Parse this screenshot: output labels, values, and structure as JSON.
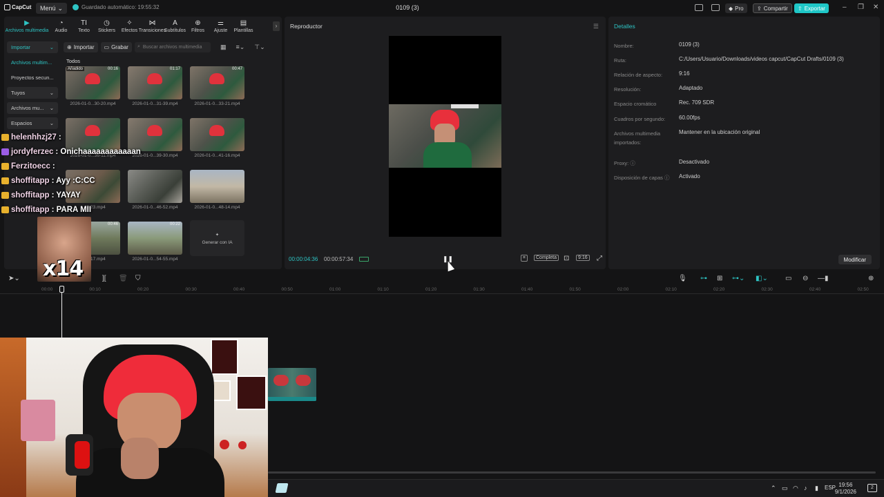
{
  "titlebar": {
    "app": "CapCut",
    "menu": "Menú",
    "autosave": "Guardado automático: 19:55:32",
    "doc_title": "0109 (3)",
    "pro": "Pro",
    "share": "Compartir",
    "export": "Exportar"
  },
  "toolbar": {
    "items": [
      {
        "label": "Archivos multimedia",
        "icon": "media-icon",
        "glyph": "▶"
      },
      {
        "label": "Audio",
        "icon": "audio-icon",
        "glyph": "◔"
      },
      {
        "label": "Texto",
        "icon": "text-icon",
        "glyph": "TI"
      },
      {
        "label": "Stickers",
        "icon": "sticker-icon",
        "glyph": "◷"
      },
      {
        "label": "Efectos",
        "icon": "effects-icon",
        "glyph": "✧"
      },
      {
        "label": "Transiciones",
        "icon": "transitions-icon",
        "glyph": "⋈"
      },
      {
        "label": "Subtítulos",
        "icon": "captions-icon",
        "glyph": "A"
      },
      {
        "label": "Filtros",
        "icon": "filters-icon",
        "glyph": "⊕"
      },
      {
        "label": "Ajuste",
        "icon": "adjust-icon",
        "glyph": "⚌"
      },
      {
        "label": "Plantillas",
        "icon": "templates-icon",
        "glyph": "▤"
      }
    ]
  },
  "sidebar": {
    "items": [
      {
        "label": "Importar",
        "chevron": "⌄"
      },
      {
        "label": "Archivos multim...",
        "chevron": ""
      },
      {
        "label": "Proyectos secun...",
        "chevron": ""
      },
      {
        "label": "Tuyos",
        "chevron": "⌄"
      },
      {
        "label": "Archivos mu...",
        "chevron": "⌄"
      },
      {
        "label": "Espacios",
        "chevron": "⌄"
      }
    ]
  },
  "media": {
    "import": "Importar",
    "record": "Grabar",
    "search_placeholder": "Buscar archivos multimedia",
    "all": "Todos",
    "added": "Añadido",
    "generate": "Generar con IA",
    "thumbs": [
      {
        "name": "2026-01-0...30-20.mp4",
        "dur": "00:16"
      },
      {
        "name": "2026-01-0...31-39.mp4",
        "dur": "01:17"
      },
      {
        "name": "2026-01-0...33-21.mp4",
        "dur": "00:47"
      },
      {
        "name": "2026-01-0...36-11.mp4",
        "dur": ""
      },
      {
        "name": "2026-01-0...39-30.mp4",
        "dur": ""
      },
      {
        "name": "2026-01-0...41-16.mp4",
        "dur": ""
      },
      {
        "name": "...43-23.mp4",
        "dur": ""
      },
      {
        "name": "2026-01-0...46-52.mp4",
        "dur": ""
      },
      {
        "name": "2026-01-0...48-14.mp4",
        "dur": ""
      },
      {
        "name": "...53-17.mp4",
        "dur": "00:46"
      },
      {
        "name": "2026-01-0...54-55.mp4",
        "dur": "00:22"
      }
    ]
  },
  "chat": {
    "lines": [
      {
        "user": "helenhhzj27",
        "msg": ": ",
        "badge": "gold"
      },
      {
        "user": "jordyferzec",
        "msg": ": Onichaaaaaaaaaaaan",
        "badge": "purple"
      },
      {
        "user": "Ferzitoecc",
        "msg": ":",
        "badge": "gold"
      },
      {
        "user": "shoffitapp",
        "msg": ": Ayy :C:CC",
        "badge": "gold"
      },
      {
        "user": "shoffitapp",
        "msg": ": YAYAY",
        "badge": "gold"
      },
      {
        "user": "shoffitapp",
        "msg": ": PARA MII",
        "badge": "gold"
      }
    ],
    "emote_count": "x14"
  },
  "player": {
    "title": "Reproductor",
    "current": "00:00:04:36",
    "total": "00:00:57:34",
    "full": "Completa",
    "ratio": "9:16"
  },
  "details": {
    "title": "Detalles",
    "rows": [
      {
        "label": "Nombre:",
        "value": "0109 (3)"
      },
      {
        "label": "Ruta:",
        "value": "C:/Users/Usuario/Downloads/videos capcut/CapCut Drafts/0109 (3)"
      },
      {
        "label": "Relación de aspecto:",
        "value": "9:16"
      },
      {
        "label": "Resolución:",
        "value": "Adaptado"
      },
      {
        "label": "Espacio cromático",
        "value": "Rec. 709 SDR"
      },
      {
        "label": "Cuadros por segundo:",
        "value": "60.00fps"
      },
      {
        "label": "Archivos multimedia importados:",
        "value": "Mantener en la ubicación original"
      },
      {
        "label": "Proxy: ⓘ",
        "value": "Desactivado"
      },
      {
        "label": "Disposición de capas ⓘ",
        "value": "Activado"
      }
    ],
    "modify": "Modificar"
  },
  "timeline": {
    "ticks": [
      "00:00",
      "00:10",
      "00:20",
      "00:30",
      "00:40",
      "00:50",
      "01:00",
      "01:10",
      "01:20",
      "01:30",
      "01:40",
      "01:50",
      "02:00",
      "02:10",
      "02:20",
      "02:30",
      "02:40",
      "02:50"
    ]
  },
  "taskbar": {
    "lang": "ESP",
    "time": "19:56",
    "date": "9/1/2026",
    "notifications": "2"
  }
}
